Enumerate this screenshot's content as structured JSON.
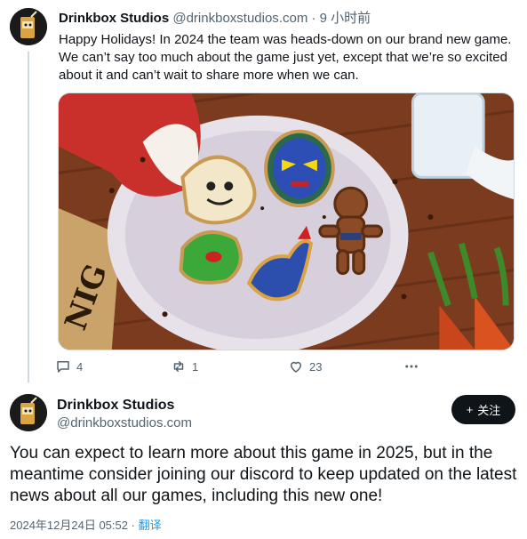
{
  "tweet1": {
    "author_name": "Drinkbox Studios",
    "handle": "@drinkboxstudios.com",
    "separator": "·",
    "time": "9 小时前",
    "text": "Happy Holidays! In 2024 the team was heads-down on our brand new game. We can’t say too much about the game just yet, except that we’re so excited about it and can’t wait to share more when we can.",
    "image_sign_text": "NIG",
    "actions": {
      "reply_count": "4",
      "retweet_count": "1",
      "like_count": "23",
      "more_icon": "more-icon"
    }
  },
  "tweet2": {
    "author_name": "Drinkbox Studios",
    "handle": "@drinkboxstudios.com",
    "follow_label": "关注",
    "follow_icon": "plus",
    "text": "You can expect to learn more about this game in 2025, but in the meantime consider joining our discord to keep updated on the latest news about all our games, including this new one!",
    "date": "2024年12月24日 05:52",
    "separator": "·",
    "translate_label": "翻译"
  },
  "colors": {
    "text": "#0f1419",
    "secondary": "#536471",
    "link": "#1d9bf0",
    "button_bg": "#0f1419"
  }
}
